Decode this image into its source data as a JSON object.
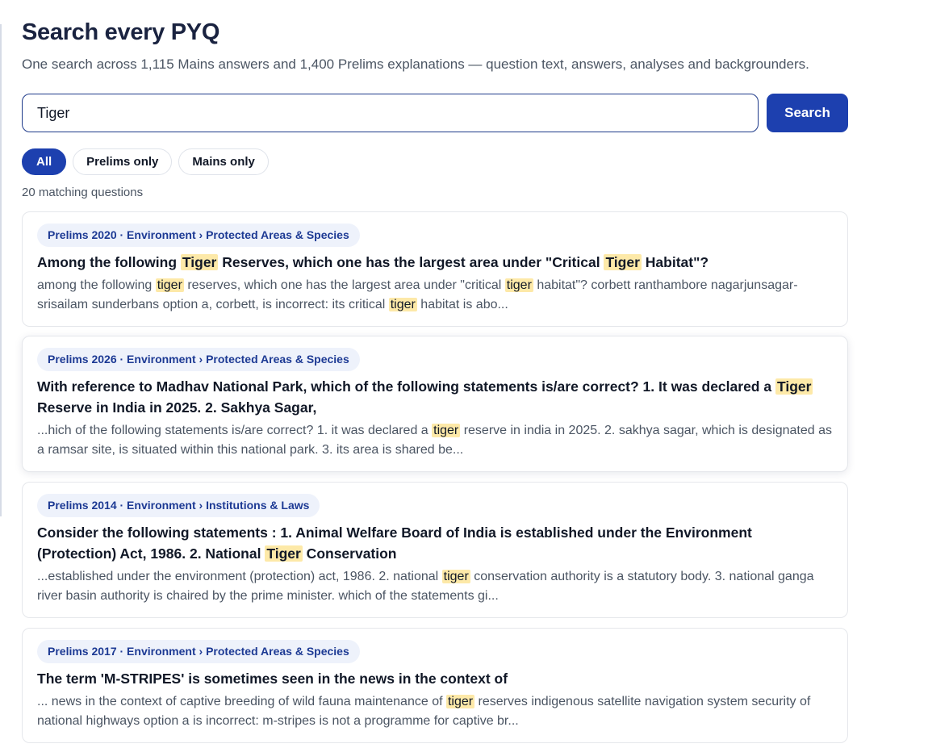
{
  "header": {
    "title": "Search every PYQ",
    "subtitle": "One search across 1,115 Mains answers and 1,400 Prelims explanations — question text, answers, analyses and backgrounders."
  },
  "search": {
    "value": "Tiger",
    "button_label": "Search"
  },
  "filters": [
    {
      "label": "All",
      "active": true
    },
    {
      "label": "Prelims only",
      "active": false
    },
    {
      "label": "Mains only",
      "active": false
    }
  ],
  "results_count": "20 matching questions",
  "highlight_color": "#fde9a8",
  "accent_color": "#1d40af",
  "results": [
    {
      "tag": "Prelims 2020 · Environment › Protected Areas & Species",
      "question": [
        {
          "t": "Among the following "
        },
        {
          "t": "Tiger",
          "hl": true
        },
        {
          "t": " Reserves, which one has the largest area under \"Critical "
        },
        {
          "t": "Tiger",
          "hl": true
        },
        {
          "t": " Habitat\"?"
        }
      ],
      "snippet": [
        {
          "t": "among the following "
        },
        {
          "t": "tiger",
          "hl": true
        },
        {
          "t": " reserves, which one has the largest area under \"critical "
        },
        {
          "t": "tiger",
          "hl": true
        },
        {
          "t": " habitat\"? corbett ranthambore nagarjunsagar-srisailam sunderbans option a, corbett, is incorrect: its critical "
        },
        {
          "t": "tiger",
          "hl": true
        },
        {
          "t": " habitat is abo..."
        }
      ]
    },
    {
      "tag": "Prelims 2026 · Environment › Protected Areas & Species",
      "question": [
        {
          "t": "With reference to Madhav National Park, which of the following statements is/are correct? 1. It was declared a "
        },
        {
          "t": "Tiger",
          "hl": true
        },
        {
          "t": " Reserve in India in 2025. 2. Sakhya Sagar,"
        }
      ],
      "snippet": [
        {
          "t": "...hich of the following statements is/are correct? 1. it was declared a "
        },
        {
          "t": "tiger",
          "hl": true
        },
        {
          "t": " reserve in india in 2025. 2. sakhya sagar, which is designated as a ramsar site, is situated within this national park. 3. its area is shared be..."
        }
      ]
    },
    {
      "tag": "Prelims 2014 · Environment › Institutions & Laws",
      "question": [
        {
          "t": "Consider the following statements : 1. Animal Welfare Board of India is established under the Environment (Protection) Act, 1986. 2. National "
        },
        {
          "t": "Tiger",
          "hl": true
        },
        {
          "t": " Conservation"
        }
      ],
      "snippet": [
        {
          "t": "...established under the environment (protection) act, 1986. 2. national "
        },
        {
          "t": "tiger",
          "hl": true
        },
        {
          "t": " conservation authority is a statutory body. 3. national ganga river basin authority is chaired by the prime minister. which of the statements gi..."
        }
      ]
    },
    {
      "tag": "Prelims 2017 · Environment › Protected Areas & Species",
      "question": [
        {
          "t": "The term 'M-STRIPES' is sometimes seen in the news in the context of"
        }
      ],
      "snippet": [
        {
          "t": "... news in the context of captive breeding of wild fauna maintenance of "
        },
        {
          "t": "tiger",
          "hl": true
        },
        {
          "t": " reserves indigenous satellite navigation system security of national highways option a is incorrect: m-stripes is not a programme for captive br..."
        }
      ]
    }
  ]
}
